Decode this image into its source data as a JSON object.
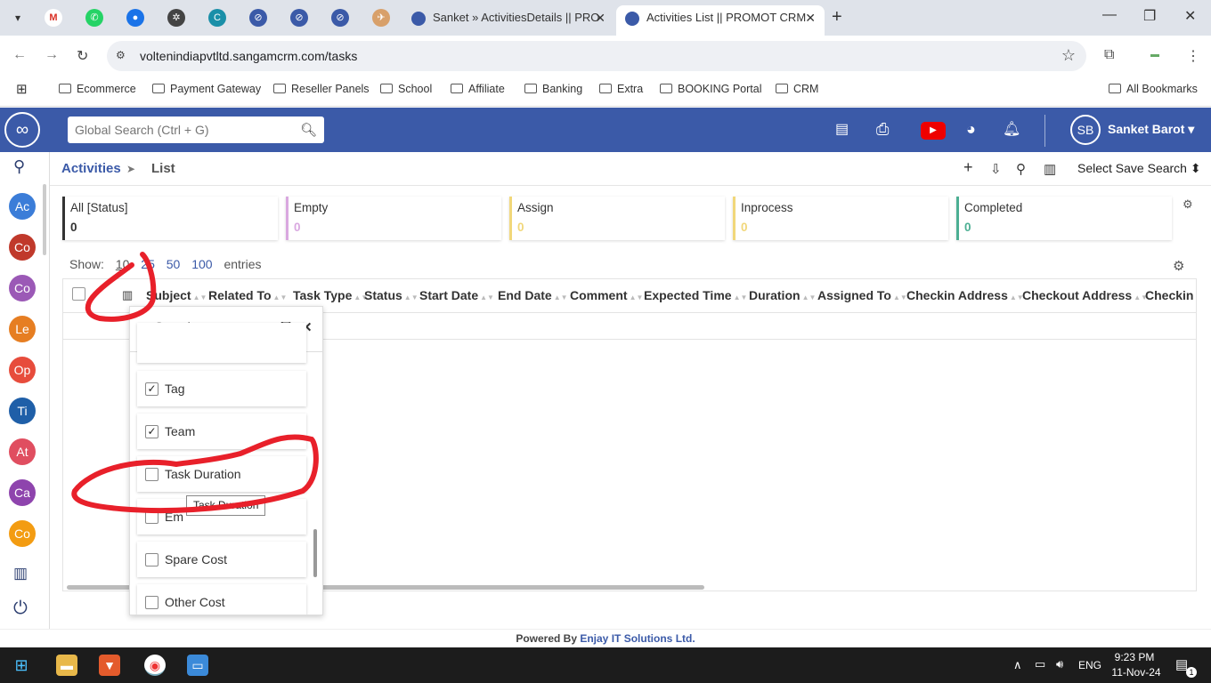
{
  "browser": {
    "tabs": [
      {
        "label": "Sanket » ActivitiesDetails || PRO",
        "active": false
      },
      {
        "label": "Activities List || PROMOT CRM",
        "active": true
      }
    ],
    "url": "voltenindiapvtltd.sangamcrm.com/tasks",
    "bookmarks": [
      "Ecommerce",
      "Payment Gateway",
      "Reseller Panels",
      "School",
      "Affiliate",
      "Banking",
      "Extra",
      "BOOKING Portal",
      "CRM"
    ],
    "all_bookmarks": "All Bookmarks"
  },
  "header": {
    "search_placeholder": "Global Search (Ctrl + G)",
    "user_initials": "SB",
    "user_name": "Sanket Barot ▾",
    "youtube_icon": "▶"
  },
  "sidebar": {
    "modules": [
      {
        "label": "Ac",
        "color": "#3b7dd8"
      },
      {
        "label": "Co",
        "color": "#c0392b"
      },
      {
        "label": "Co",
        "color": "#9b59b6"
      },
      {
        "label": "Le",
        "color": "#e67e22"
      },
      {
        "label": "Op",
        "color": "#e74c3c"
      },
      {
        "label": "Ti",
        "color": "#1f5fa8"
      },
      {
        "label": "At",
        "color": "#e04e60"
      },
      {
        "label": "Ca",
        "color": "#8e44ad"
      },
      {
        "label": "Co",
        "color": "#f39c12"
      }
    ]
  },
  "breadcrumb": {
    "module": "Activities",
    "sep": "➤",
    "page": "List"
  },
  "toolbar": {
    "save_search": "Select Save Search ⬍"
  },
  "status_cards": [
    {
      "title": "All [Status]",
      "count": "0",
      "color": "#333333"
    },
    {
      "title": "Empty",
      "count": "0",
      "color": "#d9a8e0"
    },
    {
      "title": "Assign",
      "count": "0",
      "color": "#f1d77a"
    },
    {
      "title": "Inprocess",
      "count": "0",
      "color": "#f1d77a"
    },
    {
      "title": "Completed",
      "count": "0",
      "color": "#4caf93"
    }
  ],
  "pagination": {
    "show": "Show:",
    "sizes": [
      "10",
      "25",
      "50",
      "100"
    ],
    "entries": "entries"
  },
  "table": {
    "columns": [
      "Subject",
      "Related To",
      "Task Type",
      "Status",
      "Start Date",
      "End Date",
      "Comment",
      "Expected Time",
      "Duration",
      "Assigned To",
      "Checkin Address",
      "Checkout Address",
      "Checkin I"
    ]
  },
  "column_panel": {
    "search_placeholder": "Search",
    "options": [
      {
        "label": "Tag",
        "checked": true
      },
      {
        "label": "Team",
        "checked": true
      },
      {
        "label": "Task Duration",
        "checked": false
      },
      {
        "label": "Em",
        "checked": false
      },
      {
        "label": "Spare Cost",
        "checked": false
      },
      {
        "label": "Other Cost",
        "checked": false
      }
    ],
    "tooltip": "Task Duration"
  },
  "footer": {
    "prefix": "Powered By ",
    "company": "Enjay IT Solutions Ltd."
  },
  "taskbar": {
    "lang": "ENG",
    "time": "9:23 PM",
    "date": "11-Nov-24",
    "notif": "1"
  },
  "annotation_color": "#e8202a"
}
